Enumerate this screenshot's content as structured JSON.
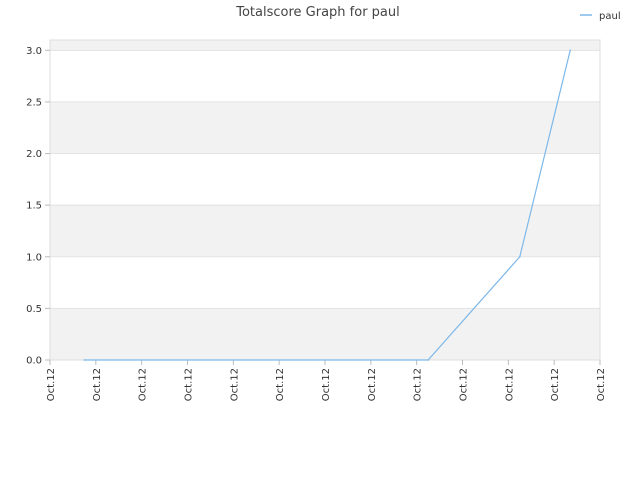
{
  "chart_data": {
    "type": "line",
    "title": "Totalscore Graph for paul",
    "xlabel": "",
    "ylabel": "",
    "ylim": [
      0,
      3.1
    ],
    "yticks": [
      "0.0",
      "0.5",
      "1.0",
      "1.5",
      "2.0",
      "2.5",
      "3.0"
    ],
    "categories": [
      "Oct.12",
      "Oct.12",
      "Oct.12",
      "Oct.12",
      "Oct.12",
      "Oct.12",
      "Oct.12",
      "Oct.12",
      "Oct.12",
      "Oct.12",
      "Oct.12",
      "Oct.12",
      "Oct.12"
    ],
    "grid": true,
    "legend_position": "top-right",
    "series": [
      {
        "name": "paul",
        "color": "#7db8ea",
        "x": [
          0.75,
          8.25,
          10.25,
          11.35
        ],
        "values": [
          0,
          0,
          1,
          3
        ]
      }
    ]
  }
}
